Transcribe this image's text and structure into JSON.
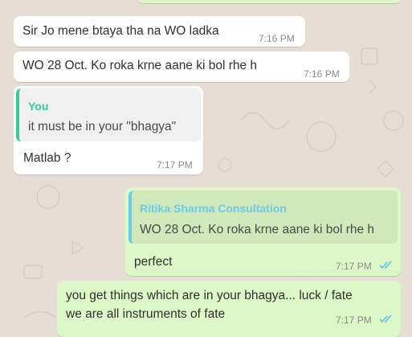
{
  "colors": {
    "incoming_bubble": "#ffffff",
    "outgoing_bubble": "#dcf8c6",
    "read_ticks": "#4fc3f7",
    "quote_author_you": "#35cd96",
    "quote_author_contact": "#6bcbef"
  },
  "messages": [
    {
      "direction": "in",
      "text": "Sir Jo mene btaya tha na WO ladka",
      "time": "7:16 PM"
    },
    {
      "direction": "in",
      "text": "WO 28 Oct. Ko roka krne aane ki bol rhe h",
      "time": "7:16 PM"
    },
    {
      "direction": "in",
      "quote": {
        "author": "You",
        "text": "it must be in your \"bhagya\""
      },
      "text": "Matlab ?",
      "time": "7:17 PM"
    },
    {
      "direction": "out",
      "quote": {
        "author": "Ritika Sharma Consultation",
        "text": "WO 28 Oct. Ko roka krne aane ki bol rhe h"
      },
      "text": "perfect",
      "time": "7:17 PM",
      "status_icon": "double-check-read-icon"
    },
    {
      "direction": "out",
      "lines": [
        "you get things which are in your bhagya... luck / fate",
        "we are all instruments of fate"
      ],
      "time": "7:17 PM",
      "status_icon": "double-check-read-icon"
    }
  ]
}
